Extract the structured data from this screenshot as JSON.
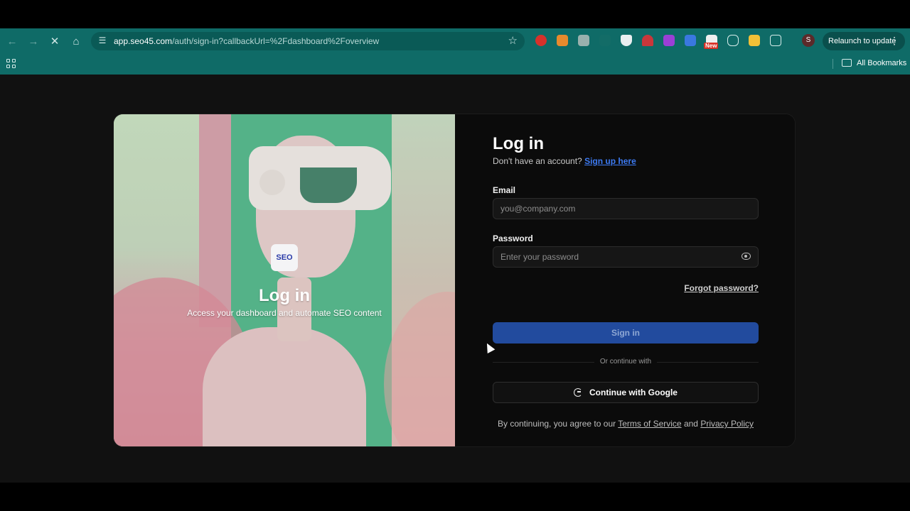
{
  "browser": {
    "url_host": "app.seo45.com",
    "url_path": "/auth/sign-in?callbackUrl=%2Fdashboard%2Foverview",
    "relaunch_label": "Relaunch to update",
    "profile_initial": "S",
    "new_badge": "New",
    "bookmarks_label": "All Bookmarks",
    "colors": {
      "chrome": "#0f6b67"
    }
  },
  "hero": {
    "logo_text": "SEO",
    "title": "Log in",
    "subtitle": "Access your dashboard and automate SEO content"
  },
  "form": {
    "title": "Log in",
    "no_account_text": "Don't have an account?",
    "signup_link": "Sign up here",
    "email_label": "Email",
    "email_placeholder": "you@company.com",
    "password_label": "Password",
    "password_placeholder": "Enter your password",
    "forgot_link": "Forgot password?",
    "signin_label": "Sign in",
    "divider_label": "Or continue with",
    "google_label": "Continue with Google",
    "terms_prefix": "By continuing, you agree to our",
    "terms_link": "Terms of Service",
    "terms_and": "and",
    "privacy_link": "Privacy Policy",
    "colors": {
      "accent": "#3d7bf4",
      "button": "#224b9e"
    }
  }
}
